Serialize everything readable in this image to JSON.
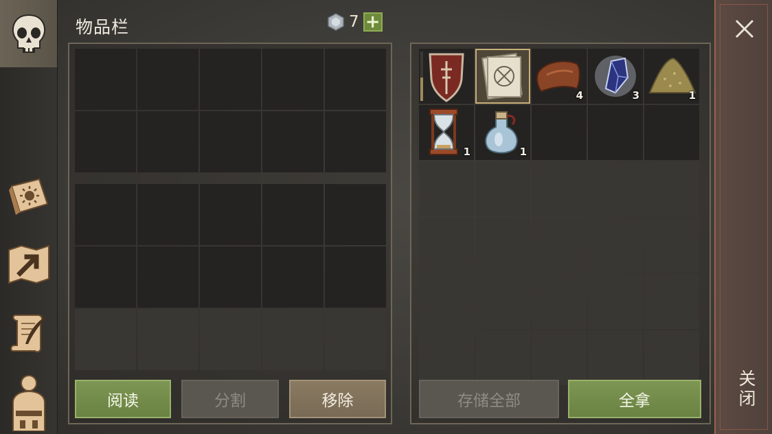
{
  "title": "物品栏",
  "currency": {
    "icon": "gem-icon",
    "amount": "7",
    "add_label": "+"
  },
  "sidebar": [
    {
      "name": "skull-icon",
      "active": true
    },
    {
      "name": "sun-book-icon"
    },
    {
      "name": "map-arrow-icon"
    },
    {
      "name": "quill-scroll-icon"
    },
    {
      "name": "backpack-character-icon"
    }
  ],
  "loot": {
    "items": [
      {
        "slot": 0,
        "icon": "shield-icon",
        "count": ""
      },
      {
        "slot": 1,
        "icon": "recipe-scroll-icon",
        "count": "",
        "selected": true
      },
      {
        "slot": 2,
        "icon": "leather-icon",
        "count": "4"
      },
      {
        "slot": 3,
        "icon": "crystal-icon",
        "count": "3"
      },
      {
        "slot": 4,
        "icon": "sand-pile-icon",
        "count": "1"
      },
      {
        "slot": 5,
        "icon": "hourglass-icon",
        "count": "1"
      },
      {
        "slot": 6,
        "icon": "potion-flask-icon",
        "count": "1"
      }
    ]
  },
  "buttons": {
    "read": "阅读",
    "split": "分割",
    "remove": "移除",
    "store_all": "存储全部",
    "take_all": "全拿"
  },
  "close": {
    "label": "关闭"
  },
  "colors": {
    "accent_green": "#7e9653",
    "close_border": "#9c5f4c",
    "slot_bg": "#242322"
  }
}
